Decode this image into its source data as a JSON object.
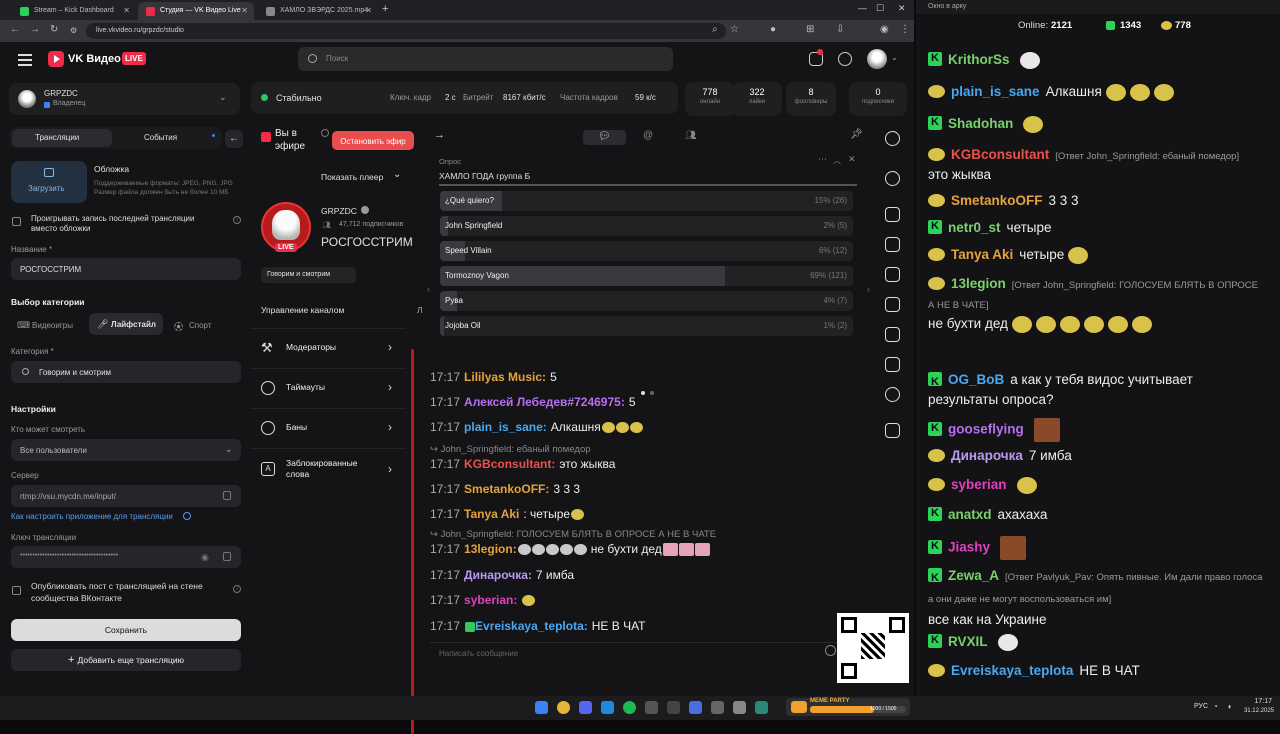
{
  "browser": {
    "tabs": [
      {
        "title": "Stream – Kick Dashboard"
      },
      {
        "title": "Студия — VK Видео Live"
      },
      {
        "title": "ХАМЛО ЗВЭРДС 2025.mp4"
      }
    ],
    "url": "live.vkvideo.ru/grpzdc/studio",
    "new_tab_label": "+"
  },
  "vk": {
    "brand": "VK Видео",
    "live_badge": "LIVE",
    "search_placeholder": "Поиск",
    "channel": {
      "name": "GRPZDC",
      "role": "Владелец"
    },
    "tabs": {
      "streams": "Трансляции",
      "events": "События"
    },
    "cover": {
      "title": "Обложка",
      "hint": "Поддерживаемые форматы: JPEG, PNG, JPG Размер файла должен быть не более 10 МБ",
      "upload": "Загрузить"
    },
    "replay_label": "Проигрывать запись последней трансляции вместо обложки",
    "name_label": "Название *",
    "name_value": "РОСГОССТРИМ",
    "category_section": "Выбор категории",
    "category_tabs": {
      "games": "Видеоигры",
      "lifestyle": "Лайфстайл",
      "sport": "Спорт"
    },
    "category_label": "Категория *",
    "category_value": "Говорим и смотрим",
    "settings_title": "Настройки",
    "who_can_watch_label": "Кто может смотреть",
    "who_can_watch_value": "Все пользователи",
    "server_label": "Сервер",
    "server_value": "rtmp://vsu.mycdn.me/input/",
    "howto_link": "Как настроить приложение для трансляции",
    "key_label": "Ключ трансляции",
    "key_value": "••••••••••••••••••••••••••••••••••••••••",
    "publish_label": "Опубликовать пост с трансляцией на стене сообщества ВКонтакте",
    "save_button": "Сохранить",
    "add_stream_button": "Добавить еще трансляцию"
  },
  "status": {
    "state": "Стабильно",
    "keyframe_label": "Ключ. кадр",
    "keyframe_value": "2 с",
    "bitrate_label": "Битрейт",
    "bitrate_value": "8167 кбит/с",
    "fps_label": "Частота кадров",
    "fps_value": "59 к/с"
  },
  "stats": [
    {
      "value": "778",
      "label": "онлайн"
    },
    {
      "value": "322",
      "label": "лайки"
    },
    {
      "value": "8",
      "label": "фолловеры"
    },
    {
      "value": "0",
      "label": "подписчики"
    }
  ],
  "live": {
    "on_air": "Вы в эфире",
    "stop_button": "Остановить эфир",
    "show_player": "Показать плеер",
    "channel_name": "GRPZDC",
    "subscribers": "47,712 подписчиков",
    "stream_title": "РОСГОССТРИМ",
    "live_badge": "LIVE",
    "category_chip": "Говорим и смотрим",
    "channel_mgmt": "Управление каналом",
    "menu": [
      {
        "label": "Модераторы"
      },
      {
        "label": "Таймауты"
      },
      {
        "label": "Баны"
      },
      {
        "label": "Заблокированные слова"
      }
    ]
  },
  "poll": {
    "label": "Опрос",
    "question": "ХАМЛО ГОДА группа Б",
    "options": [
      {
        "text": "¿Qué quiero?",
        "pct": "15% (26)",
        "fill": 15
      },
      {
        "text": "John Springfield",
        "pct": "2% (5)",
        "fill": 2
      },
      {
        "text": "Speed Villain",
        "pct": "6% (12)",
        "fill": 6
      },
      {
        "text": "Tormoznoy Vagon",
        "pct": "69% (121)",
        "fill": 69
      },
      {
        "text": "Рува",
        "pct": "4% (7)",
        "fill": 4
      },
      {
        "text": "Jojoba Oil",
        "pct": "1% (2)",
        "fill": 1
      }
    ]
  },
  "vkchat": {
    "input_placeholder": "Написать сообщение",
    "messages": [
      {
        "time": "17:17",
        "user": "Lililyas Music:",
        "text": "5",
        "color": "#e6a23c"
      },
      {
        "time": "17:17",
        "user": "Алексей Лебедев#7246975:",
        "text": "5",
        "color": "#b86ef0"
      },
      {
        "time": "17:17",
        "user": "plain_is_sane:",
        "text": "Алкашня",
        "color": "#4aa8f0"
      },
      {
        "reply": "John_Springfield: ебаный помедор"
      },
      {
        "time": "17:17",
        "user": "KGBconsultant:",
        "text": "это жыква",
        "color": "#e8524a"
      },
      {
        "time": "17:17",
        "user": "SmetankoOFF:",
        "text": "3 3 3",
        "color": "#e6a23c"
      },
      {
        "time": "17:17",
        "user": "Tanya Aki",
        "text": ": четыре",
        "color": "#e6a23c"
      },
      {
        "reply": "John_Springfield: ГОЛОСУЕМ БЛЯТЬ В ОПРОСЕ А НЕ В ЧАТЕ"
      },
      {
        "time": "17:17",
        "user": "13legion:",
        "text": "не бухти дед",
        "color": "#e6a23c"
      },
      {
        "time": "17:17",
        "user": "Динарочка:",
        "text": "7 имба",
        "color": "#b89af0"
      },
      {
        "time": "17:17",
        "user": "syberian:",
        "text": "",
        "color": "#e040c0"
      },
      {
        "time": "17:17",
        "user": "Evreiskaya_teplota:",
        "text": "НЕ В ЧАТ",
        "color": "#4aa8f0"
      }
    ]
  },
  "kick": {
    "window_title": "Окно в арку",
    "online_label": "Online:",
    "online_value": "2121",
    "followers": "1343",
    "viewers": "778",
    "messages": [
      {
        "badge": "k",
        "user": "KrithorSs",
        "text": "",
        "color": "#7ad16c"
      },
      {
        "badge": "smile",
        "user": "plain_is_sane",
        "text": "Алкашня",
        "color": "#4aa8f0"
      },
      {
        "badge": "k",
        "user": "Shadohan",
        "text": "",
        "color": "#7ad16c"
      },
      {
        "badge": "smile",
        "user": "KGBconsultant",
        "note": "[Ответ John_Springfield: ебаный помедор]",
        "text": "это жыква",
        "color": "#e8524a"
      },
      {
        "badge": "smile",
        "user": "SmetankoOFF",
        "text": "3 3 3",
        "color": "#e6a23c"
      },
      {
        "badge": "k",
        "user": "netr0_st",
        "text": "четыре",
        "color": "#7ad16c"
      },
      {
        "badge": "smile",
        "user": "Tanya Aki",
        "text": "четыре",
        "color": "#e6a23c"
      },
      {
        "badge": "smile",
        "user": "13legion",
        "note": "[Ответ John_Springfield: ГОЛОСУЕМ БЛЯТЬ В ОПРОСЕ А НЕ В ЧАТЕ]",
        "text": "не бухти дед",
        "color": "#7ad16c"
      },
      {
        "badge": "k",
        "user": "OG_BoB",
        "text": "а как у тебя видос учитывает результаты опроса?",
        "color": "#4aa8f0"
      },
      {
        "badge": "k",
        "user": "gooseflying",
        "text": "",
        "color": "#b86ef0"
      },
      {
        "badge": "smile",
        "user": "Динарочка",
        "text": "7 имба",
        "color": "#b89af0"
      },
      {
        "badge": "smile",
        "user": "syberian",
        "text": "",
        "color": "#e040c0"
      },
      {
        "badge": "k",
        "user": "anatxd",
        "text": "ахахаха",
        "color": "#7ad16c"
      },
      {
        "badge": "k",
        "user": "Jiashy",
        "text": "",
        "color": "#e040c0"
      },
      {
        "badge": "k",
        "user": "Zewa_A",
        "note": "[Ответ Pavlyuk_Pav: Опять пивные. Им дали право голоса а они даже не могут воспользоваться им]",
        "text": "все как на Украине",
        "color": "#7ad16c"
      },
      {
        "badge": "k",
        "user": "RVXIL",
        "text": "",
        "color": "#7ad16c"
      },
      {
        "badge": "smile",
        "user": "Evreiskaya_teplota",
        "text": "НЕ В ЧАТ",
        "color": "#4aa8f0"
      }
    ]
  },
  "taskbar": {
    "lang": "РУС",
    "time": "17:17",
    "date": "31.12.2025",
    "widget_title": "MEME PARTY",
    "widget_progress": "1000 / 1500"
  },
  "colors": {
    "accent_red": "#f02c4a",
    "kick_green": "#2bd357",
    "status_green": "#35c759"
  }
}
